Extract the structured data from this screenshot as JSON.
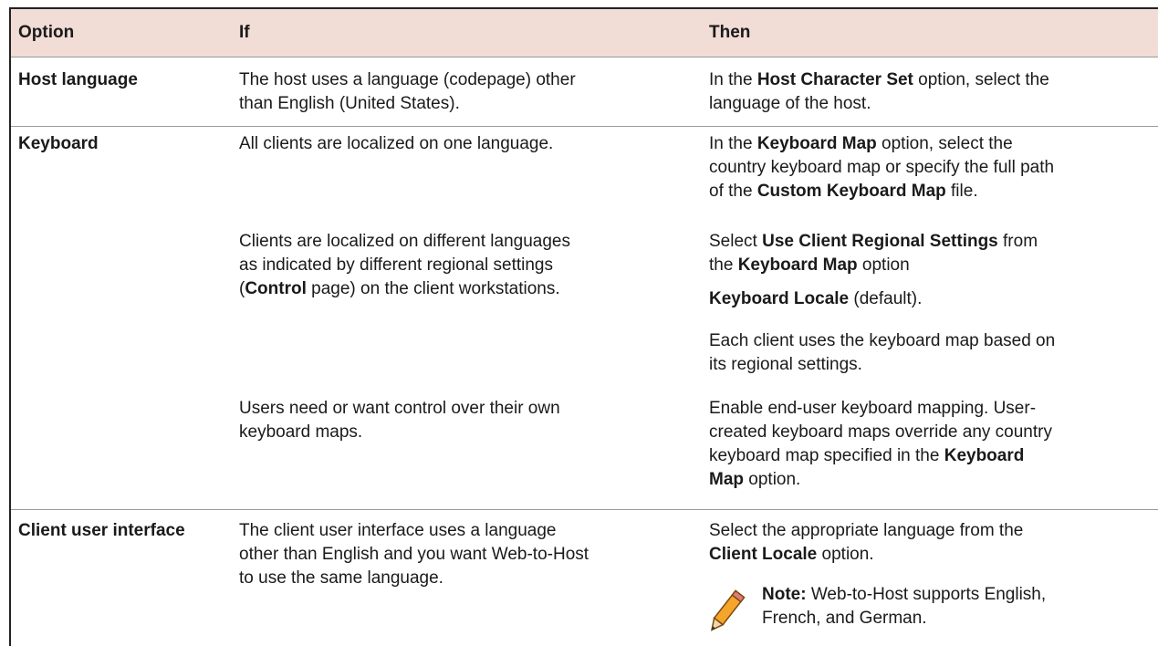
{
  "table": {
    "headers": [
      "Option",
      "If",
      "Then"
    ],
    "rows": [
      {
        "option": "Host language",
        "if": [
          "The host uses a language (codepage) other",
          "than English (United States)."
        ],
        "then": {
          "l1_pre": "In the ",
          "l1_bold": "Host Character Set",
          "l1_post": " option, select the",
          "l2": "language of the host."
        }
      },
      {
        "option": "Keyboard",
        "if": [
          "All clients are localized on one language."
        ],
        "then": {
          "l1_pre": "In the ",
          "l1_bold": "Keyboard Map",
          "l1_post": " option, select the",
          "l2": "country keyboard map or specify the full path",
          "l3_pre": "of the ",
          "l3_bold": "Custom Keyboard Map",
          "l3_post": " file."
        }
      },
      {
        "if": [
          "Clients are localized on different languages",
          "as indicated by different regional settings"
        ],
        "if_l3_pre": "(",
        "if_l3_bold": "Control",
        "if_l3_post": " page) on the client workstations.",
        "then": {
          "a1_pre": "Select ",
          "a1_bold": "Use Client Regional Settings",
          "a1_post": " from",
          "a2_pre": "the ",
          "a2_bold": "Keyboard Map",
          "a2_post": " option",
          "b1_bold": "Keyboard Locale",
          "b1_post": " (default).",
          "c1": "Each client uses the keyboard map based on",
          "c2": "its regional settings."
        }
      },
      {
        "if": [
          "Users need or want control over their own",
          "keyboard maps."
        ],
        "then": {
          "l1": "Enable end-user keyboard mapping. User-",
          "l2": "created keyboard maps override any country",
          "l3_pre": "keyboard map specified in the ",
          "l3_bold": "Keyboard",
          "l4_bold": "Map",
          "l4_post": " option."
        }
      },
      {
        "option": "Client user interface",
        "if": [
          "The client user interface uses a language",
          "other than English and you want Web-to-Host",
          "to use the same language."
        ],
        "then": {
          "l1": "Select the appropriate language from the",
          "l2_bold": "Client Locale",
          "l2_post": " option.",
          "note_bold": "Note:",
          "note_l1": " Web-to-Host supports English,",
          "note_l2": "French, and German."
        }
      }
    ]
  }
}
